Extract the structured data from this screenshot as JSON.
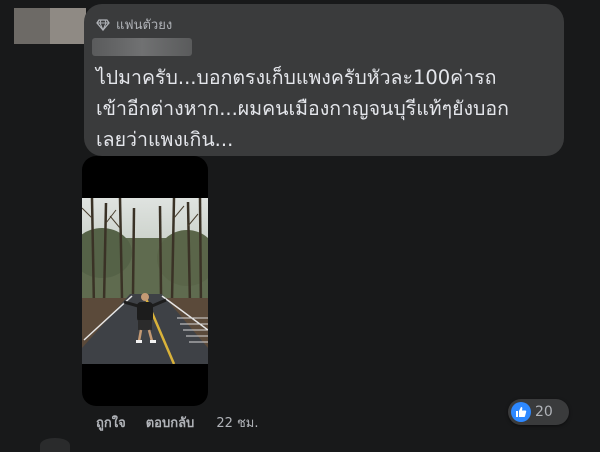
{
  "comment": {
    "badge_label": "แฟนตัวยง",
    "badge_icon": "diamond-icon",
    "text": "ไปมาครับ...บอกตรงเก็บแพงครับหัวละ100ค่ารถ\nเข้าอีกต่างหาก...ผมคนเมืองกาญจนบุรีแท้ๆยังบอก\nเลยว่าแพงเกิน...",
    "like_label": "ถูกใจ",
    "reply_label": "ตอบกลับ",
    "timestamp": "22 ชม.",
    "reaction_icon": "like-icon",
    "reaction_count": "20"
  },
  "colors": {
    "background": "#18191a",
    "bubble": "#3a3b3c",
    "text": "#e4e6eb",
    "secondary_text": "#b0b3b8",
    "like_blue": "#2d88ff"
  }
}
